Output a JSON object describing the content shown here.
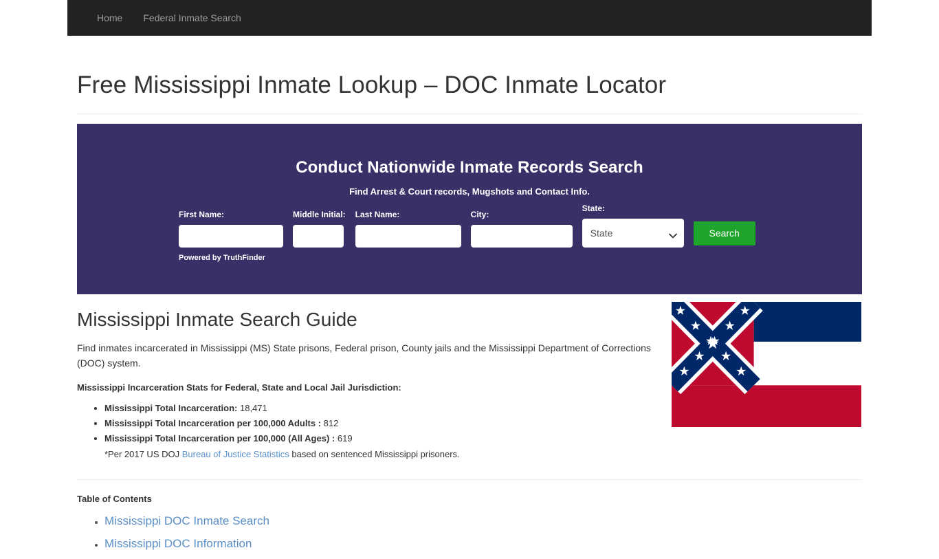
{
  "navbar": {
    "items": [
      {
        "label": "Home"
      },
      {
        "label": "Federal Inmate Search"
      }
    ]
  },
  "page": {
    "title": "Free Mississippi Inmate Lookup – DOC Inmate Locator"
  },
  "search_banner": {
    "heading": "Conduct Nationwide Inmate Records Search",
    "subheading": "Find Arrest & Court records, Mugshots and Contact Info.",
    "background_color": "#373167",
    "button_color": "#1fa42c",
    "fields": [
      {
        "label": "First Name:",
        "value": "",
        "placeholder": ""
      },
      {
        "label": "Middle Initial:",
        "value": "",
        "placeholder": ""
      },
      {
        "label": "Last Name:",
        "value": "",
        "placeholder": ""
      },
      {
        "label": "City:",
        "value": "",
        "placeholder": ""
      }
    ],
    "state_field": {
      "label": "State:",
      "selected": "State",
      "options": [
        "State"
      ]
    },
    "submit_label": "Search",
    "powered_by": "Powered by TruthFinder"
  },
  "guide": {
    "title": "Mississippi Inmate Search Guide",
    "intro": "Find inmates incarcerated in Mississippi (MS) State prisons, Federal prison, County jails and the Mississippi Department of Corrections (DOC) system.",
    "stats_heading": "Mississippi Incarceration Stats for Federal, State and Local Jail Jurisdiction:",
    "stats": [
      {
        "label": "Mississippi Total Incarceration:",
        "value": "18,471"
      },
      {
        "label": "Mississippi Total Incarceration per 100,000 Adults :",
        "value": "812"
      },
      {
        "label": "Mississippi Total Incarceration per 100,000 (All Ages) :",
        "value": "619"
      }
    ],
    "footnote_prefix": "*Per 2017 US DOJ ",
    "footnote_link": "Bureau of Justice Statistics",
    "footnote_suffix": " based on sentenced Mississippi prisoners."
  },
  "flag": {
    "name": "mississippi-state-flag",
    "red": "#bf0a30",
    "blue": "#002868",
    "white": "#ffffff"
  },
  "toc": {
    "title": "Table of Contents",
    "items": [
      {
        "label": "Mississippi DOC Inmate Search"
      },
      {
        "label": "Mississippi DOC Information"
      }
    ]
  }
}
